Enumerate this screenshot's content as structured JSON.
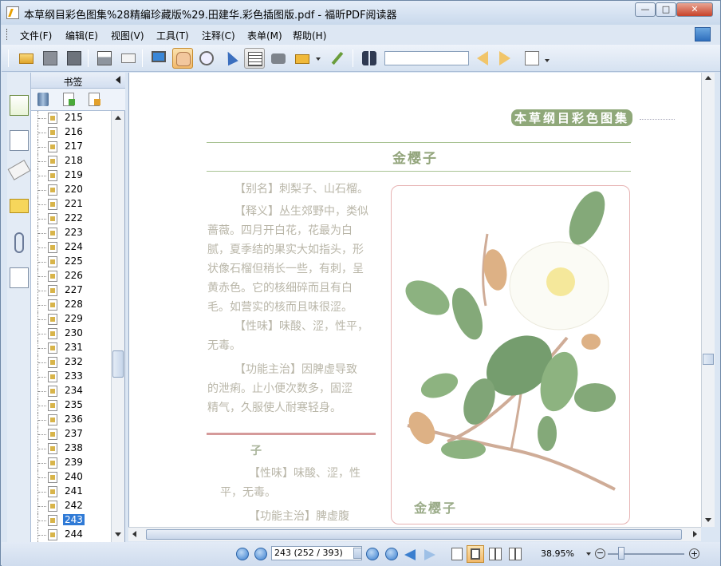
{
  "window": {
    "title": "本草纲目彩色图集%28精编珍藏版%29.田建华.彩色插图版.pdf - 福昕PDF阅读器"
  },
  "menu": [
    "文件(F)",
    "编辑(E)",
    "视图(V)",
    "工具(T)",
    "注释(C)",
    "表单(M)",
    "帮助(H)"
  ],
  "toolbar": {
    "search_value": ""
  },
  "panel": {
    "title": "书签",
    "bookmarks": [
      "215",
      "216",
      "217",
      "218",
      "219",
      "220",
      "221",
      "222",
      "223",
      "224",
      "225",
      "226",
      "227",
      "228",
      "229",
      "230",
      "231",
      "232",
      "233",
      "234",
      "235",
      "236",
      "237",
      "238",
      "239",
      "240",
      "241",
      "242",
      "243",
      "244"
    ],
    "selected": "243"
  },
  "page": {
    "running_head": "本草纲目彩色图集",
    "entry_title": "金樱子",
    "alias": "【别名】刺梨子、山石榴。",
    "desc_lines": [
      "【释义】丛生郊野中，类似",
      "蔷薇。四月开白花，花最为白",
      "腻，夏季结的果实大如指头，形",
      "状像石榴但稍长一些，有刺，呈",
      "黄赤色。它的核细碎而且有白",
      "毛。如营实的核而且味很涩。"
    ],
    "nature": "【性味】味酸、涩，性平，",
    "nature_cont": "无毒。",
    "function_lines": [
      "【功能主治】因脾虚导致",
      "的泄痢。止小便次数多，固涩",
      "精气，久服使人耐寒轻身。"
    ],
    "sub_title": "子",
    "sub_nature": "【性味】味酸、涩，性",
    "sub_nature_cont": "平，无毒。",
    "sub_function": "【功能主治】脾虚腹",
    "plate_caption": "金樱子"
  },
  "status": {
    "page_field": "243 (252 / 393)",
    "zoom": "38.95%"
  }
}
